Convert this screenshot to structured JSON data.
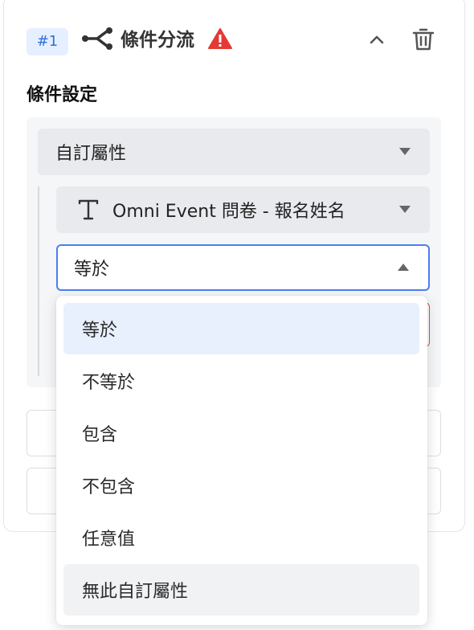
{
  "rule": {
    "badge": "#1",
    "title": "條件分流",
    "icons": [
      "branch-icon",
      "warning-icon",
      "chevron-up-icon",
      "trash-icon"
    ],
    "warning_color": "#e53935"
  },
  "condition": {
    "section_label": "條件設定",
    "attribute_select": "自訂屬性",
    "field_select": "Omni Event 問卷 - 報名姓名",
    "field_icon": "text-type-icon",
    "operator_select": "等於"
  },
  "operator_menu": {
    "options": [
      "等於",
      "不等於",
      "包含",
      "不包含",
      "任意值",
      "無此自訂屬性"
    ],
    "selected": "等於"
  },
  "colors": {
    "accent": "#4a7ff0",
    "badge_bg": "#e6efff",
    "badge_text": "#2f6fe0",
    "error_border": "#e34d4d"
  }
}
